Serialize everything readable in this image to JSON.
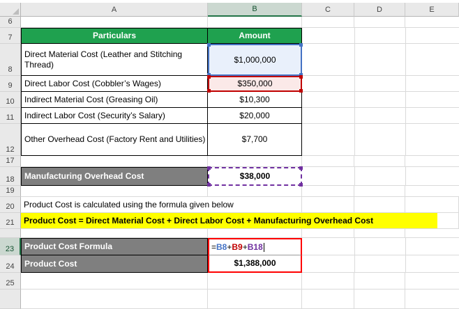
{
  "grid": {
    "col_headers": [
      "A",
      "B",
      "C",
      "D",
      "E"
    ],
    "row_numbers": [
      "6",
      "7",
      "8",
      "9",
      "10",
      "11",
      "12",
      "17",
      "18",
      "19",
      "20",
      "21",
      "",
      "23",
      "24",
      "25"
    ]
  },
  "cost_table": {
    "header": {
      "particulars": "Particulars",
      "amount": "Amount"
    },
    "rows": [
      {
        "label": "Direct Material Cost (Leather and Stitching Thread)",
        "amount": "$1,000,000"
      },
      {
        "label": "Direct Labor Cost (Cobbler’s Wages)",
        "amount": "$350,000"
      },
      {
        "label": "Indirect Material Cost (Greasing Oil)",
        "amount": "$10,300"
      },
      {
        "label": "Indirect Labor Cost (Security’s Salary)",
        "amount": "$20,000"
      },
      {
        "label": "Other Overhead Cost (Factory Rent and Utilities)",
        "amount": "$7,700"
      }
    ]
  },
  "overhead_row": {
    "label": "Manufacturing Overhead Cost",
    "amount": "$38,000"
  },
  "note_text": "Product Cost is calculated using the formula given below",
  "formula_banner": "Product Cost = Direct Material Cost + Direct Labor Cost + Manufacturing Overhead Cost",
  "formula_row": {
    "label": "Product Cost Formula",
    "formula": {
      "equals": "=",
      "ref1": "B8",
      "plus1": "+",
      "ref2": "B9",
      "plus2": "+",
      "ref3": "B18"
    }
  },
  "result_row": {
    "label": "Product Cost",
    "amount": "$1,388,000"
  },
  "colors": {
    "header_green": "#1FA14F",
    "label_gray": "#7F7F7F",
    "highlight_yellow": "#FFFF00",
    "ref_blue": "#4472C4",
    "ref_blue_fill": "#E9F0FB",
    "ref_red": "#C00000",
    "ref_red_fill": "#FBE9E8",
    "ref_purple": "#7030A0",
    "selection_red": "#FF0000"
  }
}
